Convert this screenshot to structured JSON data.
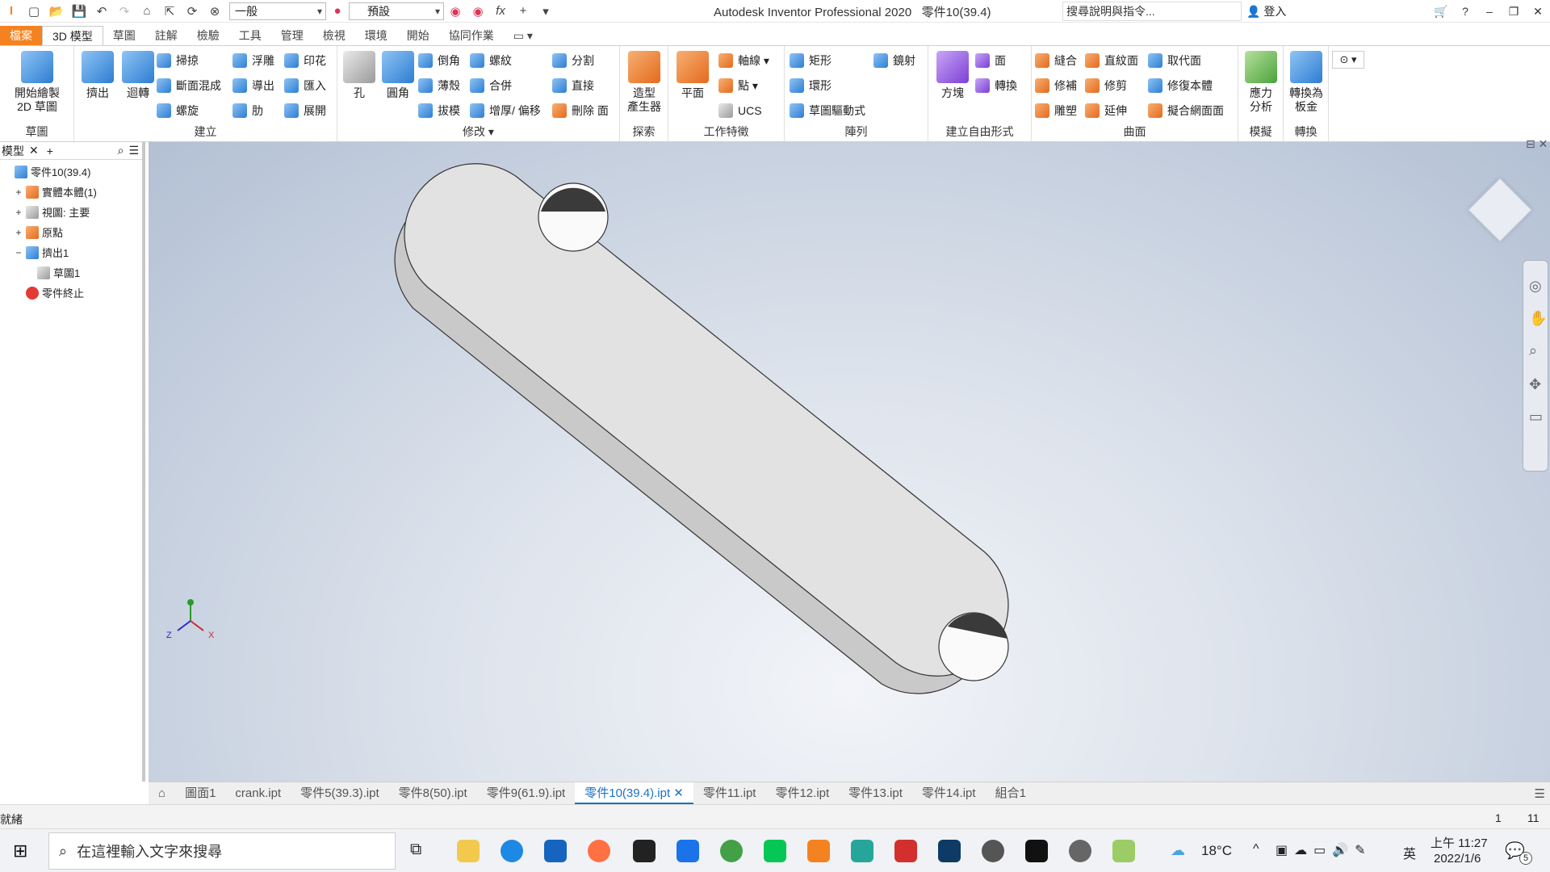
{
  "app": {
    "title": "Autodesk Inventor Professional 2020",
    "document": "零件10(39.4)",
    "search_placeholder": "搜尋說明與指令...",
    "login": "登入",
    "style_dropdown": "一般",
    "appearance_dropdown": "預設"
  },
  "tabs": [
    "檔案",
    "3D 模型",
    "草圖",
    "註解",
    "檢驗",
    "工具",
    "管理",
    "檢視",
    "環境",
    "開始",
    "協同作業"
  ],
  "ribbon": {
    "sketch": {
      "label": "草圖",
      "start": "開始繪製\n2D 草圖"
    },
    "create": {
      "label": "建立",
      "extrude": "擠出",
      "revolve": "迴轉",
      "sweep": "掃掠",
      "loft": "斷面混成",
      "coil": "螺旋",
      "emboss": "浮雕",
      "derive": "導出",
      "rib": "肋",
      "decal": "印花",
      "import": "匯入",
      "unfold": "展開"
    },
    "modify": {
      "label": "修改",
      "hole": "孔",
      "fillet": "圓角",
      "chamfer": "倒角",
      "thread": "螺紋",
      "shell": "薄殼",
      "combine": "合併",
      "draft": "拔模",
      "thicken": "增厚/ 偏移",
      "split": "分割",
      "direct": "直接",
      "delete_face": "刪除 面"
    },
    "explore": {
      "label": "探索",
      "shape_gen": "造型\n產生器"
    },
    "work": {
      "label": "工作特徵",
      "plane": "平面",
      "axis": "軸線",
      "point": "點",
      "ucs": "UCS"
    },
    "pattern": {
      "label": "陣列",
      "rect": "矩形",
      "circ": "環形",
      "sketch_driven": "草圖驅動式",
      "mirror": "鏡射"
    },
    "freeform": {
      "label": "建立自由形式",
      "box": "方塊",
      "face": "面",
      "convert": "轉換"
    },
    "surface": {
      "label": "曲面",
      "stitch": "縫合",
      "ruled": "直紋面",
      "replace": "取代面",
      "patch": "修補",
      "trim": "修剪",
      "repair": "修復本體",
      "sculpt": "雕塑",
      "extend": "延伸",
      "fit_mesh": "擬合網面面"
    },
    "simulation": {
      "label": "模擬",
      "stress": "應力\n分析"
    },
    "convert": {
      "label": "轉換",
      "sheet_metal": "轉換為\n板金"
    }
  },
  "browser": {
    "tab": "模型",
    "nodes": [
      {
        "label": "零件10(39.4)",
        "indent": 0,
        "toggle": ""
      },
      {
        "label": "實體本體(1)",
        "indent": 1,
        "toggle": "+"
      },
      {
        "label": "視圖: 主要",
        "indent": 1,
        "toggle": "+"
      },
      {
        "label": "原點",
        "indent": 1,
        "toggle": "+"
      },
      {
        "label": "擠出1",
        "indent": 1,
        "toggle": "−"
      },
      {
        "label": "草圖1",
        "indent": 2,
        "toggle": ""
      },
      {
        "label": "零件終止",
        "indent": 1,
        "toggle": ""
      }
    ]
  },
  "doc_tabs": [
    "圖面1",
    "crank.ipt",
    "零件5(39.3).ipt",
    "零件8(50).ipt",
    "零件9(61.9).ipt",
    "零件10(39.4).ipt",
    "零件11.ipt",
    "零件12.ipt",
    "零件13.ipt",
    "零件14.ipt",
    "組合1"
  ],
  "active_doc_tab": "零件10(39.4).ipt",
  "status": {
    "text": "就緒",
    "count1": "1",
    "count2": "11"
  },
  "taskbar": {
    "search_placeholder": "在這裡輸入文字來搜尋",
    "temp": "18°C",
    "ime": "英",
    "time": "上午 11:27",
    "date": "2022/1/6",
    "notifications": "5"
  },
  "triad": {
    "x": "X",
    "z": "Z"
  }
}
